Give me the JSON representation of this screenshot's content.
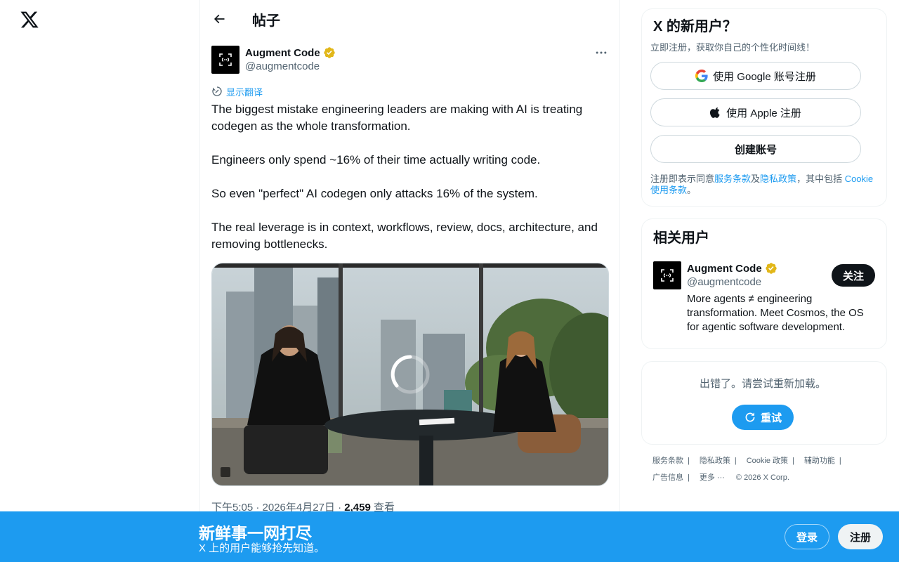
{
  "header": {
    "title": "帖子"
  },
  "post": {
    "author_name": "Augment Code",
    "author_handle": "@augmentcode",
    "translate_label": "显示翻译",
    "text": "The biggest mistake engineering leaders are making with AI is treating codegen as the whole transformation.\n\nEngineers only spend ~16% of their time actually writing code.\n\nSo even \"perfect\" AI codegen only attacks 16% of the system.\n\nThe real leverage is in context, workflows, review, docs, architecture, and removing bottlenecks.",
    "time": "下午5:05 · 2026年4月27日 · ",
    "views": "2,459",
    "views_label": " 查看"
  },
  "signup_card": {
    "title": "X 的新用户？",
    "subtitle": "立即注册，获取你自己的个性化时间线！",
    "google_label": "使用 Google 账号注册",
    "apple_label": "使用 Apple 注册",
    "create_label": "创建账号",
    "terms_prefix": "注册即表示同意",
    "terms_link": "服务条款",
    "terms_and": "及",
    "privacy_link": "隐私政策",
    "terms_mid": "，其中包括 ",
    "cookie_link": "Cookie 使用条款",
    "terms_end": "。"
  },
  "related": {
    "title": "相关用户",
    "name": "Augment Code",
    "handle": "@augmentcode",
    "follow_label": "关注",
    "bio": "More agents ≠ engineering transformation. Meet Cosmos, the OS for agentic software development."
  },
  "error_card": {
    "message": "出错了。请尝试重新加载。",
    "retry_label": "重试"
  },
  "footer": {
    "links": [
      "服务条款",
      "隐私政策",
      "Cookie 政策",
      "辅助功能",
      "广告信息",
      "更多 ···"
    ],
    "copyright": "© 2026 X Corp."
  },
  "bottom_bar": {
    "title": "新鲜事一网打尽",
    "subtitle": "X 上的用户能够抢先知道。",
    "login_label": "登录",
    "signup_label": "注册"
  },
  "colors": {
    "accent": "#1d9bf0",
    "verified": "#e2b719",
    "text": "#0f1419",
    "muted": "#536471"
  }
}
